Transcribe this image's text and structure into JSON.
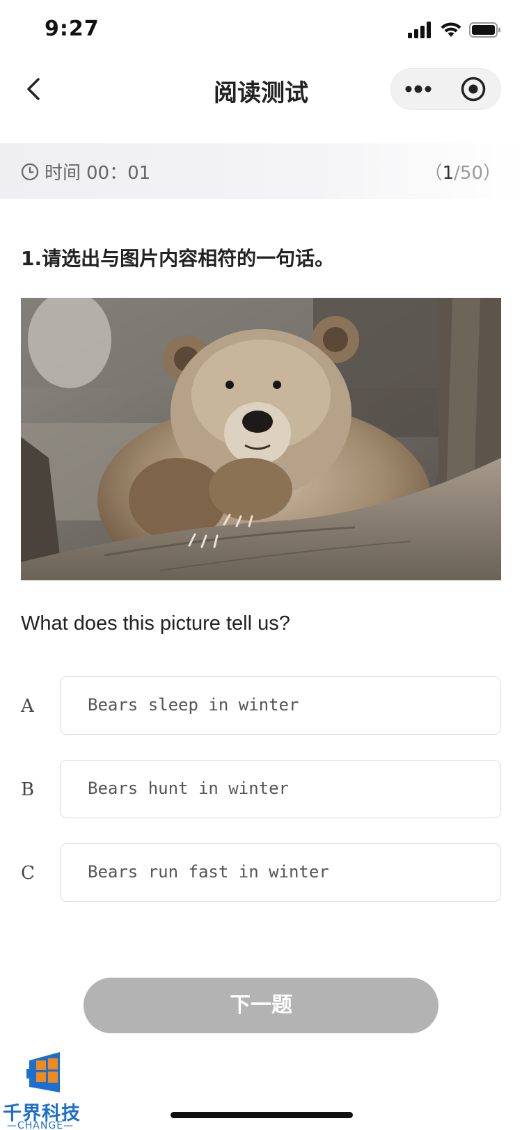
{
  "status_bar": {
    "time": "9:27",
    "icons": [
      "signal-icon",
      "wifi-icon",
      "battery-icon"
    ]
  },
  "nav": {
    "title": "阅读测试",
    "back_icon": "chevron-left-icon",
    "more_icon": "more-dots-icon",
    "close_icon": "target-circle-icon"
  },
  "timer": {
    "icon": "clock-icon",
    "label": "时间",
    "value": "00：01",
    "progress_open": "（",
    "progress_current": "1",
    "progress_rest": "/50）"
  },
  "question": {
    "title": "1.请选出与图片内容相符的一句话。",
    "image_description": "bear-photo",
    "text": "What does this picture tell us?",
    "options": [
      {
        "letter": "A",
        "text": "Bears sleep in winter"
      },
      {
        "letter": "B",
        "text": "Bears hunt in winter"
      },
      {
        "letter": "C",
        "text": "Bears run fast in winter"
      }
    ]
  },
  "next_button": {
    "label": "下一题"
  },
  "watermark": {
    "name": "千界科技",
    "sub": "—CHANGE—"
  },
  "colors": {
    "button_disabled": "#b3b3b3",
    "watermark_blue": "#1b6fd0",
    "watermark_orange": "#f08a1c"
  }
}
